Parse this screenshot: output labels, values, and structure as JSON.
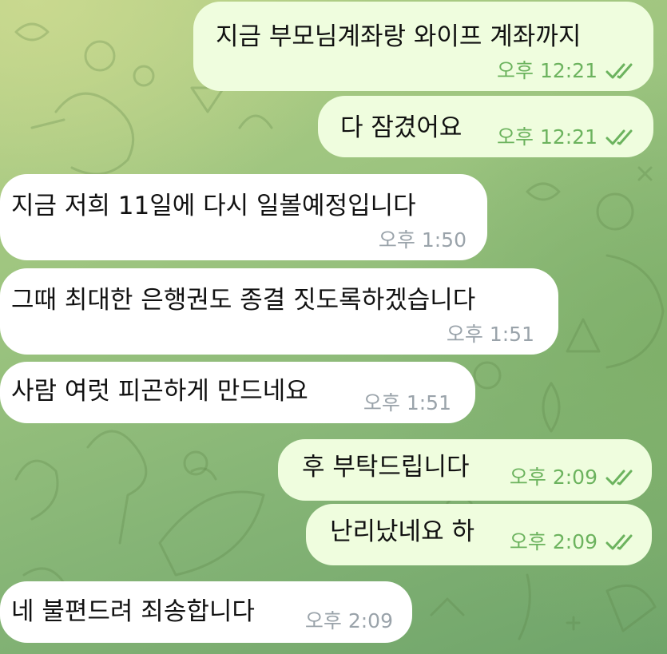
{
  "colors": {
    "incoming_bubble": "#ffffff",
    "outgoing_bubble": "#effdde",
    "incoming_time": "#9aa3aa",
    "outgoing_time": "#6cb35e",
    "wallpaper": "#9cc47f"
  },
  "messages": [
    {
      "direction": "outgoing",
      "text": "지금 부모님계좌랑 와이프 계좌까지",
      "time": "오후 12:21",
      "status_icon": "double-check-icon"
    },
    {
      "direction": "outgoing",
      "text": "다 잠겼어요",
      "time": "오후 12:21",
      "status_icon": "double-check-icon"
    },
    {
      "direction": "incoming",
      "text": "지금 저희 11일에 다시 일볼예정입니다",
      "time": "오후 1:50"
    },
    {
      "direction": "incoming",
      "text": "그때 최대한 은행권도 종결 짓도록하겠습니다",
      "time": "오후 1:51"
    },
    {
      "direction": "incoming",
      "text": "사람 여럿 피곤하게 만드네요",
      "time": "오후 1:51"
    },
    {
      "direction": "outgoing",
      "text": "후 부탁드립니다",
      "time": "오후 2:09",
      "status_icon": "double-check-icon"
    },
    {
      "direction": "outgoing",
      "text": "난리났네요 하",
      "time": "오후 2:09",
      "status_icon": "double-check-icon"
    },
    {
      "direction": "incoming",
      "text": "네 불편드려 죄송합니다",
      "time": "오후 2:09"
    }
  ]
}
